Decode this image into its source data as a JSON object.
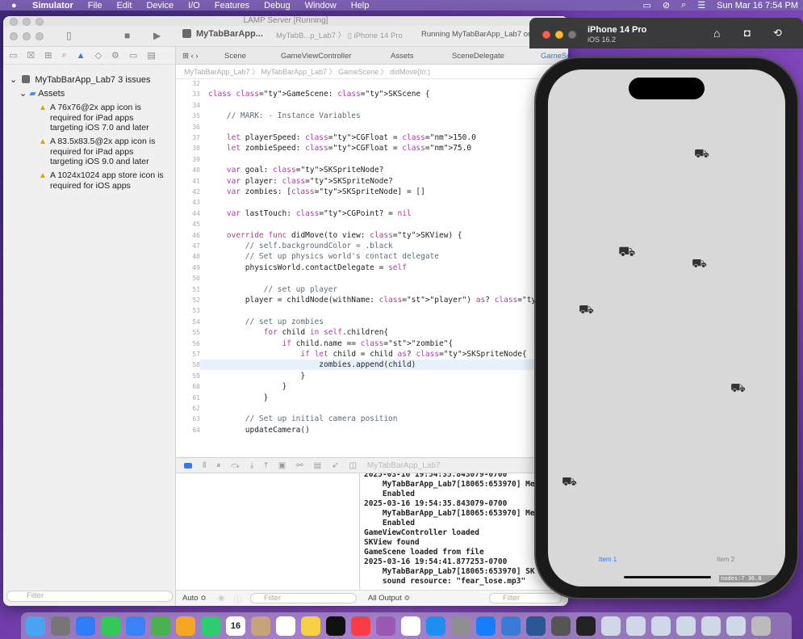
{
  "menubar": {
    "apple": "",
    "app": "Simulator",
    "items": [
      "File",
      "Edit",
      "Device",
      "I/O",
      "Features",
      "Debug",
      "Window",
      "Help"
    ],
    "clock": "Sun Mar 16  7:54 PM"
  },
  "xcode": {
    "window_title": "LAMP Server [Running]",
    "scheme": "MyTabBarApp...",
    "device_crumb": "MyTabB...p_Lab7",
    "device": "iPhone 14 Pro",
    "status": "Running MyTabBarApp_Lab7 on",
    "tabs": [
      "Scene",
      "GameViewController",
      "Assets",
      "SceneDelegate",
      "GameScene"
    ],
    "jumpbar": "MyTabBarApp_Lab7  〉  MyTabBarApp_Lab7  〉  GameScene  〉  didMove(to:)",
    "navigator": {
      "project": "MyTabBarApp_Lab7",
      "issues": "3 issues",
      "group": "Assets",
      "warnings": [
        "A 76x76@2x app icon is required for iPad apps targeting iOS 7.0 and later",
        "A 83.5x83.5@2x app icon is required for iPad apps targeting iOS 9.0 and later",
        "A 1024x1024 app store icon is required for iOS apps"
      ],
      "filter_placeholder": "Filter"
    },
    "code_lines": [
      {
        "n": "32",
        "t": ""
      },
      {
        "n": "33",
        "t": "class GameScene: SKScene {"
      },
      {
        "n": "34",
        "t": ""
      },
      {
        "n": "35",
        "t": "    // MARK: - Instance Variables"
      },
      {
        "n": "36",
        "t": ""
      },
      {
        "n": "37",
        "t": "    let playerSpeed: CGFloat = 150.0"
      },
      {
        "n": "38",
        "t": "    let zombieSpeed: CGFloat = 75.0"
      },
      {
        "n": "39",
        "t": ""
      },
      {
        "n": "40",
        "t": "    var goal: SKSpriteNode?"
      },
      {
        "n": "41",
        "t": "    var player: SKSpriteNode?"
      },
      {
        "n": "42",
        "t": "    var zombies: [SKSpriteNode] = []"
      },
      {
        "n": "43",
        "t": ""
      },
      {
        "n": "44",
        "t": "    var lastTouch: CGPoint? = nil"
      },
      {
        "n": "45",
        "t": ""
      },
      {
        "n": "46",
        "t": "    override func didMove(to view: SKView) {"
      },
      {
        "n": "47",
        "t": "        // self.backgroundColor = .black"
      },
      {
        "n": "48",
        "t": "        // Set up physics world's contact delegate"
      },
      {
        "n": "49",
        "t": "        physicsWorld.contactDelegate = self"
      },
      {
        "n": "50",
        "t": ""
      },
      {
        "n": "51",
        "t": "            // set up player"
      },
      {
        "n": "52",
        "t": "        player = childNode(withName: \"player\") as? SKSpriteNode"
      },
      {
        "n": "53",
        "t": ""
      },
      {
        "n": "54",
        "t": "        // set up zombies"
      },
      {
        "n": "55",
        "t": "            for child in self.children{"
      },
      {
        "n": "56",
        "t": "                if child.name == \"zombie\"{"
      },
      {
        "n": "57",
        "t": "                    if let child = child as? SKSpriteNode{"
      },
      {
        "n": "58",
        "t": "                        zombies.append(child)"
      },
      {
        "n": "59",
        "t": "                    }"
      },
      {
        "n": "60",
        "t": "                }"
      },
      {
        "n": "61",
        "t": "            }"
      },
      {
        "n": "62",
        "t": ""
      },
      {
        "n": "63",
        "t": "        // Set up initial camera position"
      },
      {
        "n": "64",
        "t": "        updateCamera()"
      }
    ],
    "debug_target": "MyTabBarApp_Lab7",
    "console_lines": [
      "2025-03-16 19:54:35.843079-0700",
      "    MyTabBarApp_Lab7[18065:653970] Me",
      "    Enabled",
      "2025-03-16 19:54:35.843079-0700",
      "    MyTabBarApp_Lab7[18065:653970] Me",
      "    Enabled",
      "GameViewController loaded",
      "SKView found",
      "GameScene loaded from file",
      "2025-03-16 19:54:41.877253-0700",
      "    MyTabBarApp_Lab7[18065:653970] SK",
      "    sound resource: \"fear_lose.mp3\""
    ],
    "auto_label": "Auto ≎",
    "vars_filter": "Filter",
    "output_label": "All Output ≎",
    "console_filter": "Filter"
  },
  "simulator": {
    "device": "iPhone 14 Pro",
    "os": "iOS 16.2",
    "tab_item_1": "Item 1",
    "tab_item_2": "Item 2",
    "nodes_label": "nodes:7  36.0"
  },
  "dock_icons": [
    "finder",
    "launchpad",
    "safari",
    "messages",
    "mail",
    "maps",
    "photos",
    "facetime",
    "calendar",
    "contacts",
    "reminders",
    "notes",
    "tv",
    "music",
    "podcasts",
    "news",
    "appstore",
    "settings",
    "xcode",
    "preview",
    "virtualbox",
    "vmware",
    "terminal",
    "window-1",
    "window-2",
    "window-3",
    "window-4",
    "window-5",
    "window-6",
    "trash"
  ],
  "calendar_day": "16"
}
